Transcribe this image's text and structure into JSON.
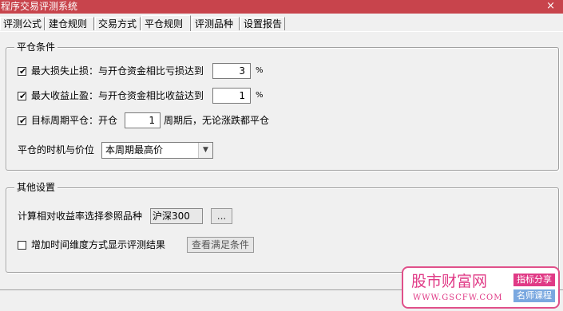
{
  "window": {
    "title": "程序交易评测系统",
    "close_label": "×"
  },
  "tabs": [
    {
      "label": "评测公式"
    },
    {
      "label": "建仓规则"
    },
    {
      "label": "交易方式"
    },
    {
      "label": "平仓规则"
    },
    {
      "label": "评测品种"
    },
    {
      "label": "设置报告"
    }
  ],
  "active_tab": "平仓规则",
  "close_conditions": {
    "title": "平仓条件",
    "max_loss": {
      "checked": true,
      "label": "最大损失止损：与开仓资金相比亏损达到",
      "value": "3",
      "unit": "%"
    },
    "max_profit": {
      "checked": true,
      "label": "最大收益止盈：与开仓资金相比收益达到",
      "value": "1",
      "unit": "%"
    },
    "target_period": {
      "checked": true,
      "label": "目标周期平仓：开仓",
      "value": "1",
      "suffix": "周期后，无论涨跌都平仓"
    },
    "timing": {
      "label": "平仓的时机与价位",
      "selected": "本周期最高价"
    }
  },
  "other_settings": {
    "title": "其他设置",
    "reference": {
      "label": "计算相对收益率选择参照品种",
      "value": "沪深300",
      "button_label": "..."
    },
    "time_dimension": {
      "checked": false,
      "label": "增加时间维度方式显示评测结果",
      "button_label": "查看满足条件"
    }
  },
  "watermark": {
    "main_text": "股市财富网",
    "url_text": "WWW.GSCFW.COM",
    "tag1": "指标分享",
    "tag2": "名师课程"
  }
}
